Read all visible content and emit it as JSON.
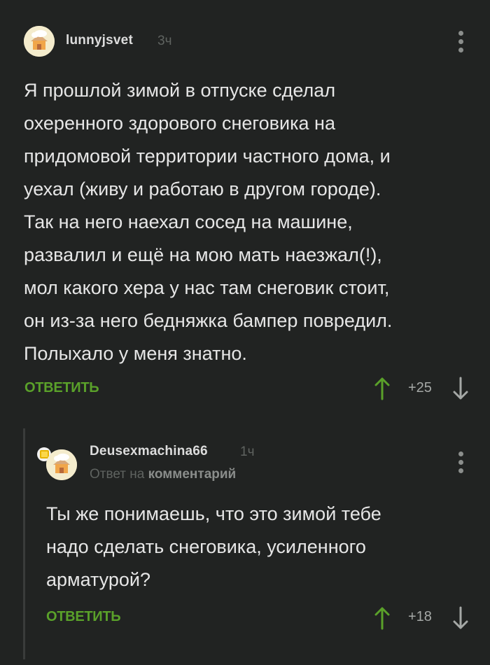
{
  "comments": [
    {
      "username": "lunnyjsvet",
      "time": "3ч",
      "text": "Я прошлой зимой в отпуске сделал\nохеренного здорового снеговика на\nпридомовой территории частного дома, и\nуехал (живу и работаю в другом городе).\nТак на него наехал сосед на машине,\nразвалил и ещё на мою мать наезжал(!),\nмол какого хера у нас там снеговик стоит,\nон из-за него бедняжка бампер повредил.\nПолыхало у меня знатно.",
      "reply_label": "ОТВЕТИТЬ",
      "rating": "+25"
    },
    {
      "username": "Deusexmachina66",
      "time": "1ч",
      "reply_to_prefix": "Ответ на",
      "reply_to_target": "комментарий",
      "text": "Ты же понимаешь, что это зимой тебе\nнадо сделать снеговика, усиленного\nарматурой?",
      "reply_label": "ОТВЕТИТЬ",
      "rating": "+18"
    }
  ],
  "colors": {
    "background": "#212322",
    "accent": "#5aa12a",
    "muted": "#5f6360",
    "text": "#e6e6e6"
  },
  "icons": {
    "avatar": "house-avatar-icon",
    "menu": "kebab-menu-icon",
    "upvote": "arrow-up-icon",
    "downvote": "arrow-down-icon",
    "badge": "online-badge-icon"
  }
}
